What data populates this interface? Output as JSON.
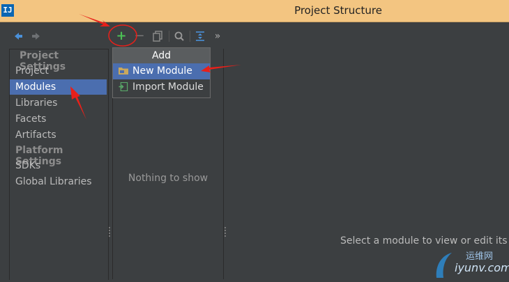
{
  "window": {
    "title": "Project Structure",
    "app_icon_text": "IJ"
  },
  "toolbar": {
    "back_icon": "arrow-left-icon",
    "forward_icon": "arrow-right-icon",
    "add_glyph": "+",
    "remove_glyph": "−",
    "more_glyph": "»"
  },
  "sidebar": {
    "project_settings_header": "Project Settings",
    "platform_settings_header": "Platform Settings",
    "items": [
      {
        "label": "Project"
      },
      {
        "label": "Modules"
      },
      {
        "label": "Libraries"
      },
      {
        "label": "Facets"
      },
      {
        "label": "Artifacts"
      },
      {
        "label": "SDKs"
      },
      {
        "label": "Global Libraries"
      }
    ]
  },
  "middle": {
    "empty_text": "Nothing to show"
  },
  "main": {
    "empty_text": "Select a module to view or edit its de"
  },
  "popup": {
    "title": "Add",
    "items": [
      {
        "label": "New Module"
      },
      {
        "label": "Import Module"
      }
    ]
  },
  "watermark": {
    "cn_text": "运维网",
    "domain_text": "iyunv.com"
  },
  "colors": {
    "titlebar": "#f3c581",
    "selection": "#4b6eaf",
    "background": "#3c3f41",
    "annotation": "#e8201a"
  }
}
